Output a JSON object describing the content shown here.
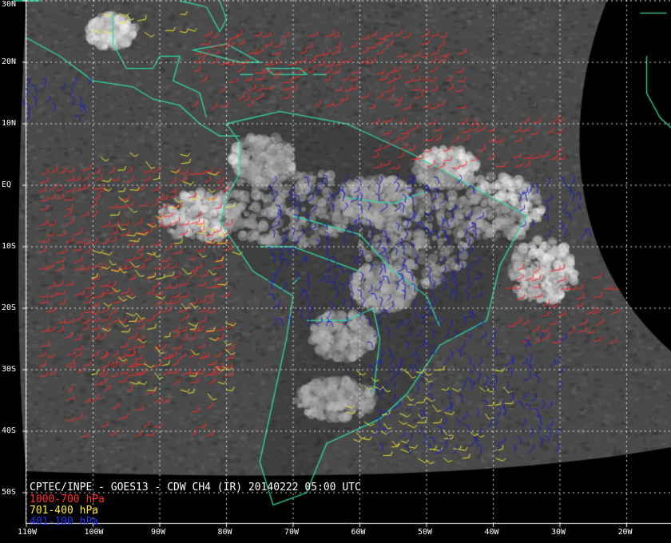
{
  "colors": {
    "low": "#ff2a2a",
    "mid": "#f2e630",
    "high": "#1a1acc",
    "coast": "#30d8a8",
    "grid": "#e8e8e8",
    "background": "#000000"
  },
  "lat_labels": [
    {
      "text": "30N",
      "lat": 30
    },
    {
      "text": "20N",
      "lat": 20
    },
    {
      "text": "10N",
      "lat": 10
    },
    {
      "text": "EQ",
      "lat": 0
    },
    {
      "text": "10S",
      "lat": -10
    },
    {
      "text": "20S",
      "lat": -20
    },
    {
      "text": "30S",
      "lat": -30
    },
    {
      "text": "40S",
      "lat": -40
    },
    {
      "text": "50S",
      "lat": -50
    }
  ],
  "lon_labels": [
    {
      "text": "110W",
      "lon": -110
    },
    {
      "text": "100W",
      "lon": -100
    },
    {
      "text": "90W",
      "lon": -90
    },
    {
      "text": "80W",
      "lon": -80
    },
    {
      "text": "70W",
      "lon": -70
    },
    {
      "text": "60W",
      "lon": -60
    },
    {
      "text": "50W",
      "lon": -50
    },
    {
      "text": "40W",
      "lon": -40
    },
    {
      "text": "30W",
      "lon": -30
    },
    {
      "text": "20W",
      "lon": -20
    }
  ],
  "legend": {
    "title": "CPTEC/INPE - GOES13 - CDW CH4 (IR) 20140222 05:00 UTC",
    "red": "1000-700 hPa",
    "yellow": "701-400 hPa",
    "blue": "401-100 hPa"
  },
  "wind_regions": [
    {
      "layer": "low",
      "lat": [
        12,
        24
      ],
      "lon": [
        -85,
        -45
      ],
      "density": 0.55
    },
    {
      "layer": "low",
      "lat": [
        2,
        10
      ],
      "lon": [
        -58,
        -30
      ],
      "density": 0.5
    },
    {
      "layer": "low",
      "lat": [
        -32,
        2
      ],
      "lon": [
        -108,
        -80
      ],
      "density": 0.5
    },
    {
      "layer": "low",
      "lat": [
        -42,
        -28
      ],
      "lon": [
        -104,
        -82
      ],
      "density": 0.3
    },
    {
      "layer": "low",
      "lat": [
        -26,
        -14
      ],
      "lon": [
        -38,
        -22
      ],
      "density": 0.35
    },
    {
      "layer": "mid",
      "lat": [
        -35,
        5
      ],
      "lon": [
        -100,
        -78
      ],
      "density": 0.22
    },
    {
      "layer": "mid",
      "lat": [
        -45,
        -30
      ],
      "lon": [
        -62,
        -38
      ],
      "density": 0.35
    },
    {
      "layer": "mid",
      "lat": [
        24,
        28
      ],
      "lon": [
        -100,
        -85
      ],
      "density": 0.35
    },
    {
      "layer": "high",
      "lat": [
        -24,
        0
      ],
      "lon": [
        -73,
        -42
      ],
      "density": 0.55
    },
    {
      "layer": "high",
      "lat": [
        -10,
        0
      ],
      "lon": [
        -36,
        -25
      ],
      "density": 0.5
    },
    {
      "layer": "high",
      "lat": [
        -45,
        -25
      ],
      "lon": [
        -58,
        -30
      ],
      "density": 0.45
    },
    {
      "layer": "high",
      "lat": [
        10,
        16
      ],
      "lon": [
        -110,
        -100
      ],
      "density": 0.4
    }
  ]
}
